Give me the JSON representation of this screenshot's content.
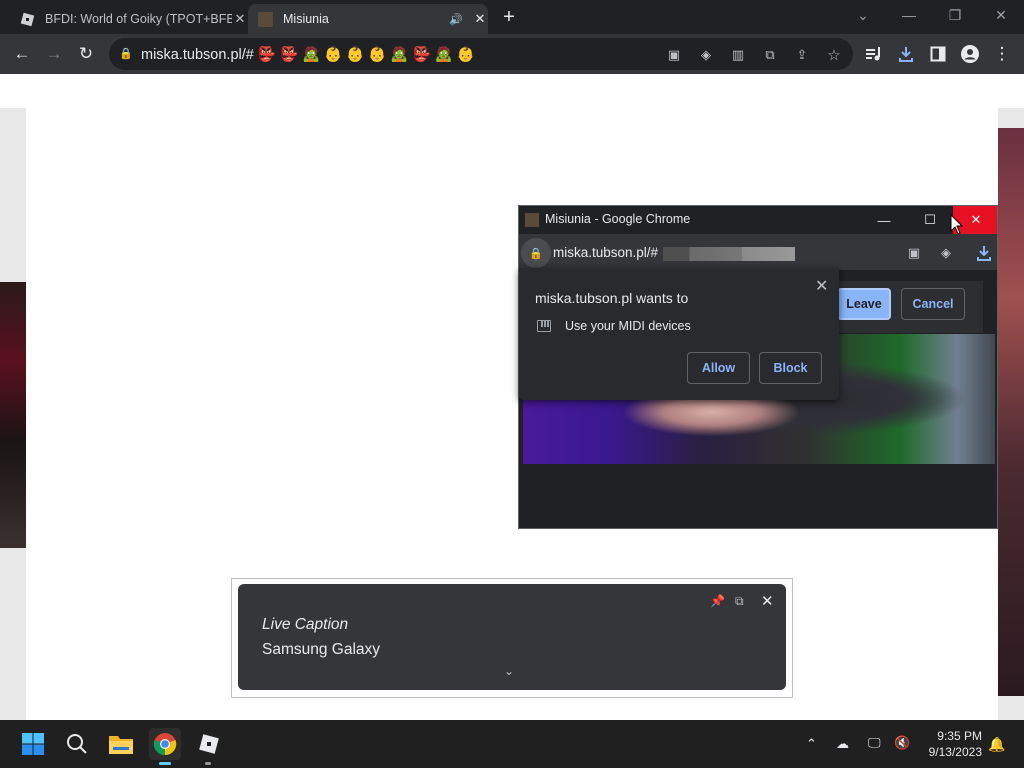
{
  "browser": {
    "tabs": [
      {
        "title": "BFDI: World of Goiky (TPOT+BFB",
        "favicon": "roblox-favicon",
        "close": "✕"
      },
      {
        "title": "Misiunia",
        "favicon": "site-favicon",
        "audio": "🔊",
        "close": "✕"
      }
    ],
    "new_tab": "+",
    "window_controls": {
      "dropdown": "⌄",
      "minimize": "—",
      "restore": "❐",
      "close": "✕"
    },
    "toolbar": {
      "back": "←",
      "forward": "→",
      "reload": "↻"
    },
    "address": {
      "url": "miska.tubson.pl/# 👺 👺 🧟 👶 👶 👶 🧟 👺 🧟 👶"
    },
    "address_icons": [
      "popup-blocked-icon",
      "extension-icon",
      "columns-icon",
      "translate-icon",
      "share-icon",
      "star-icon"
    ],
    "right_icons": [
      "media-icon",
      "download-icon",
      "sidepanel-icon",
      "profile-icon",
      "menu-icon"
    ]
  },
  "popup": {
    "title": "Misiunia - Google Chrome",
    "url": "miska.tubson.pl/#",
    "buttons": {
      "leave": "Leave",
      "cancel": "Cancel"
    }
  },
  "permission": {
    "title": "miska.tubson.pl wants to",
    "request": "Use your MIDI devices",
    "allow": "Allow",
    "block": "Block"
  },
  "live_caption": {
    "title": "Live Caption",
    "text": "Samsung Galaxy"
  },
  "taskbar": {
    "apps": [
      "start",
      "search",
      "file-explorer",
      "chrome",
      "roblox"
    ],
    "time": "9:35 PM",
    "date": "9/13/2023"
  },
  "colors": {
    "accent": "#8ab4f8",
    "close_red": "#e81123",
    "taskbar_accent": "#60cdff"
  }
}
